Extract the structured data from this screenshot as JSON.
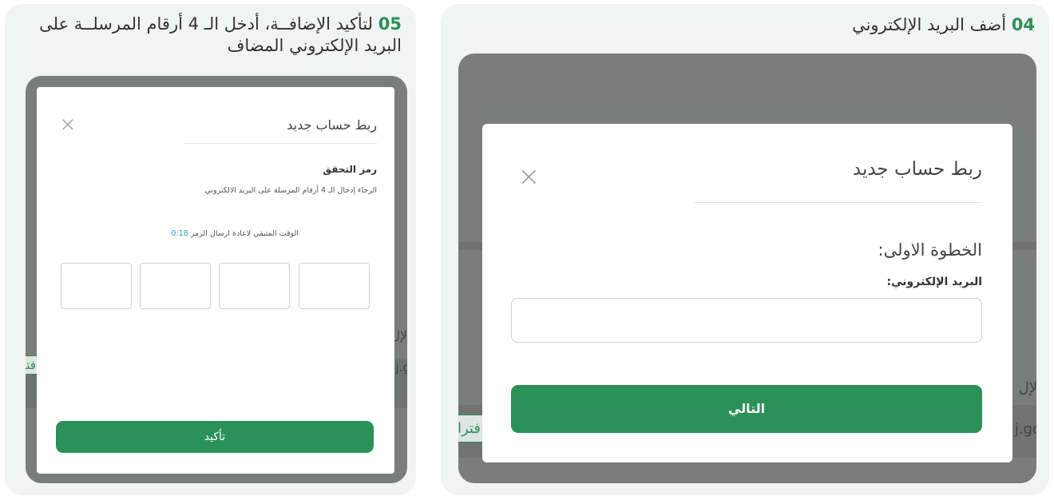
{
  "step5": {
    "number": "05",
    "title": "لتأكيد الإضافــة، أدخل الـ 4 أرقام المرسلــة على البريد الإلكتروني المضاف",
    "modal": {
      "title": "ربط حساب جديد",
      "close": "×",
      "heading": "رمز التحقق",
      "instructions": "الرجاء إدخال الـ 4 أرقام المرسلة على البريد الالكتروني",
      "timer_label": "الوقت المتبقي لاعادة ارسال الرمز",
      "timer_value": "0:18",
      "confirm_label": "تأكيد"
    },
    "background_fragments": [
      "الإل",
      "j.g",
      "فتر"
    ]
  },
  "step4": {
    "number": "04",
    "title": "أضف البريد الإلكتروني",
    "modal": {
      "title": "ربط حساب جديد",
      "close": "×",
      "step_heading": "الخطوة الاولى:",
      "email_label": "البريد الإلكتروني:",
      "email_value": "",
      "next_label": "التالي"
    },
    "background_fragments": [
      ". الإل",
      "j.go",
      "فترا"
    ]
  },
  "colors": {
    "accent": "#2a9157",
    "overlay": "#7a7d7c",
    "card": "#f2f3f3"
  }
}
